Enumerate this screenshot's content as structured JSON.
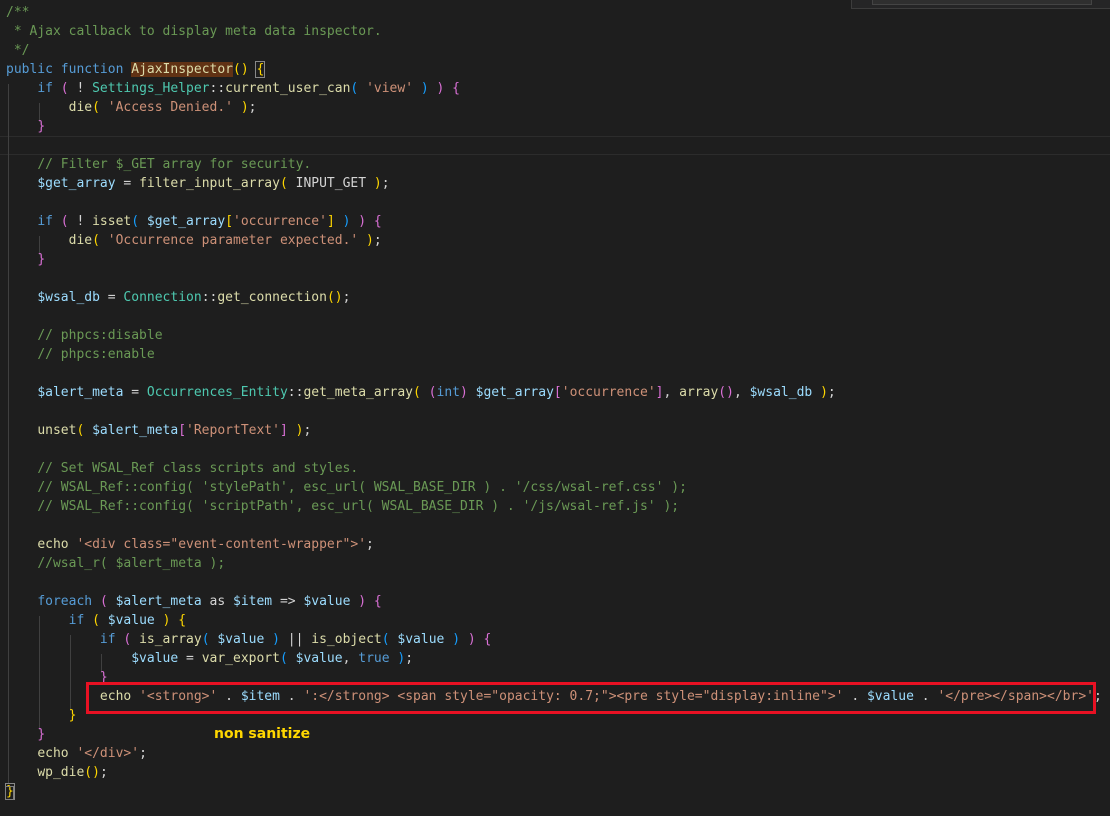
{
  "colors": {
    "background": "#1e1e1e",
    "highlight_box": "#e81123",
    "annotation": "#ffd700"
  },
  "annotation": {
    "label": "non sanitize"
  },
  "code_lines": [
    [
      [
        "/**",
        "cm"
      ]
    ],
    [
      [
        " * Ajax callback to display meta data inspector.",
        "cm"
      ]
    ],
    [
      [
        " */",
        "cm"
      ]
    ],
    [
      [
        "public",
        "kw"
      ],
      [
        " ",
        "tx"
      ],
      [
        "function",
        "kw"
      ],
      [
        " ",
        "tx"
      ],
      [
        "AjaxInspector",
        "fnhl"
      ],
      [
        "()",
        "p1"
      ],
      [
        " ",
        "tx"
      ],
      [
        "{",
        "brhl"
      ]
    ],
    [
      [
        "    ",
        "tx"
      ],
      [
        "if",
        "kw"
      ],
      [
        " ",
        "tx"
      ],
      [
        "(",
        "p2"
      ],
      [
        " ! ",
        "tx"
      ],
      [
        "Settings_Helper",
        "cls"
      ],
      [
        "::",
        "tx"
      ],
      [
        "current_user_can",
        "fn"
      ],
      [
        "(",
        "p3"
      ],
      [
        " ",
        "tx"
      ],
      [
        "'view'",
        "str"
      ],
      [
        " ",
        "tx"
      ],
      [
        ")",
        "p3"
      ],
      [
        " ",
        "tx"
      ],
      [
        ")",
        "p2"
      ],
      [
        " ",
        "tx"
      ],
      [
        "{",
        "p2"
      ]
    ],
    [
      [
        "        ",
        "tx"
      ],
      [
        "die",
        "fn"
      ],
      [
        "(",
        "p1"
      ],
      [
        " ",
        "tx"
      ],
      [
        "'Access Denied.'",
        "str"
      ],
      [
        " ",
        "tx"
      ],
      [
        ")",
        "p1"
      ],
      [
        ";",
        "tx"
      ]
    ],
    [
      [
        "    ",
        "tx"
      ],
      [
        "}",
        "p2"
      ]
    ],
    [
      [
        "",
        "tx"
      ]
    ],
    [
      [
        "    ",
        "tx"
      ],
      [
        "// Filter $_GET array for security.",
        "cm"
      ]
    ],
    [
      [
        "    ",
        "tx"
      ],
      [
        "$get_array",
        "var"
      ],
      [
        " = ",
        "tx"
      ],
      [
        "filter_input_array",
        "fn"
      ],
      [
        "(",
        "p1"
      ],
      [
        " INPUT_GET ",
        "tx"
      ],
      [
        ")",
        "p1"
      ],
      [
        ";",
        "tx"
      ]
    ],
    [
      [
        "",
        "tx"
      ]
    ],
    [
      [
        "    ",
        "tx"
      ],
      [
        "if",
        "kw"
      ],
      [
        " ",
        "tx"
      ],
      [
        "(",
        "p2"
      ],
      [
        " ! ",
        "tx"
      ],
      [
        "isset",
        "fn"
      ],
      [
        "(",
        "p3"
      ],
      [
        " ",
        "tx"
      ],
      [
        "$get_array",
        "var"
      ],
      [
        "[",
        "p1"
      ],
      [
        "'occurrence'",
        "str"
      ],
      [
        "]",
        "p1"
      ],
      [
        " ",
        "tx"
      ],
      [
        ")",
        "p3"
      ],
      [
        " ",
        "tx"
      ],
      [
        ")",
        "p2"
      ],
      [
        " ",
        "tx"
      ],
      [
        "{",
        "p2"
      ]
    ],
    [
      [
        "        ",
        "tx"
      ],
      [
        "die",
        "fn"
      ],
      [
        "(",
        "p1"
      ],
      [
        " ",
        "tx"
      ],
      [
        "'Occurrence parameter expected.'",
        "str"
      ],
      [
        " ",
        "tx"
      ],
      [
        ")",
        "p1"
      ],
      [
        ";",
        "tx"
      ]
    ],
    [
      [
        "    ",
        "tx"
      ],
      [
        "}",
        "p2"
      ]
    ],
    [
      [
        "",
        "tx"
      ]
    ],
    [
      [
        "    ",
        "tx"
      ],
      [
        "$wsal_db",
        "var"
      ],
      [
        " = ",
        "tx"
      ],
      [
        "Connection",
        "cls"
      ],
      [
        "::",
        "tx"
      ],
      [
        "get_connection",
        "fn"
      ],
      [
        "()",
        "p1"
      ],
      [
        ";",
        "tx"
      ]
    ],
    [
      [
        "",
        "tx"
      ]
    ],
    [
      [
        "    ",
        "tx"
      ],
      [
        "// phpcs:disable",
        "cm"
      ]
    ],
    [
      [
        "    ",
        "tx"
      ],
      [
        "// phpcs:enable",
        "cm"
      ]
    ],
    [
      [
        "",
        "tx"
      ]
    ],
    [
      [
        "    ",
        "tx"
      ],
      [
        "$alert_meta",
        "var"
      ],
      [
        " = ",
        "tx"
      ],
      [
        "Occurrences_Entity",
        "cls"
      ],
      [
        "::",
        "tx"
      ],
      [
        "get_meta_array",
        "fn"
      ],
      [
        "(",
        "p1"
      ],
      [
        " ",
        "tx"
      ],
      [
        "(",
        "p2"
      ],
      [
        "int",
        "kw"
      ],
      [
        ")",
        "p2"
      ],
      [
        " ",
        "tx"
      ],
      [
        "$get_array",
        "var"
      ],
      [
        "[",
        "p2"
      ],
      [
        "'occurrence'",
        "str"
      ],
      [
        "]",
        "p2"
      ],
      [
        ", ",
        "tx"
      ],
      [
        "array",
        "fn"
      ],
      [
        "()",
        "p2"
      ],
      [
        ", ",
        "tx"
      ],
      [
        "$wsal_db",
        "var"
      ],
      [
        " ",
        "tx"
      ],
      [
        ")",
        "p1"
      ],
      [
        ";",
        "tx"
      ]
    ],
    [
      [
        "",
        "tx"
      ]
    ],
    [
      [
        "    ",
        "tx"
      ],
      [
        "unset",
        "fn"
      ],
      [
        "(",
        "p1"
      ],
      [
        " ",
        "tx"
      ],
      [
        "$alert_meta",
        "var"
      ],
      [
        "[",
        "p2"
      ],
      [
        "'ReportText'",
        "str"
      ],
      [
        "]",
        "p2"
      ],
      [
        " ",
        "tx"
      ],
      [
        ")",
        "p1"
      ],
      [
        ";",
        "tx"
      ]
    ],
    [
      [
        "",
        "tx"
      ]
    ],
    [
      [
        "    ",
        "tx"
      ],
      [
        "// Set WSAL_Ref class scripts and styles.",
        "cm"
      ]
    ],
    [
      [
        "    ",
        "tx"
      ],
      [
        "// WSAL_Ref::config( 'stylePath', esc_url( WSAL_BASE_DIR ) . '/css/wsal-ref.css' );",
        "cm"
      ]
    ],
    [
      [
        "    ",
        "tx"
      ],
      [
        "// WSAL_Ref::config( 'scriptPath', esc_url( WSAL_BASE_DIR ) . '/js/wsal-ref.js' );",
        "cm"
      ]
    ],
    [
      [
        "",
        "tx"
      ]
    ],
    [
      [
        "    ",
        "tx"
      ],
      [
        "echo",
        "fn"
      ],
      [
        " ",
        "tx"
      ],
      [
        "'<div class=\"event-content-wrapper\">'",
        "str"
      ],
      [
        ";",
        "tx"
      ]
    ],
    [
      [
        "    ",
        "tx"
      ],
      [
        "//wsal_r( $alert_meta );",
        "cm"
      ]
    ],
    [
      [
        "",
        "tx"
      ]
    ],
    [
      [
        "    ",
        "tx"
      ],
      [
        "foreach",
        "kw"
      ],
      [
        " ",
        "tx"
      ],
      [
        "(",
        "p2"
      ],
      [
        " ",
        "tx"
      ],
      [
        "$alert_meta",
        "var"
      ],
      [
        " as ",
        "tx"
      ],
      [
        "$item",
        "var"
      ],
      [
        " => ",
        "tx"
      ],
      [
        "$value",
        "var"
      ],
      [
        " ",
        "tx"
      ],
      [
        ")",
        "p2"
      ],
      [
        " ",
        "tx"
      ],
      [
        "{",
        "p2"
      ]
    ],
    [
      [
        "        ",
        "tx"
      ],
      [
        "if",
        "kw"
      ],
      [
        " ",
        "tx"
      ],
      [
        "(",
        "p1"
      ],
      [
        " ",
        "tx"
      ],
      [
        "$value",
        "var"
      ],
      [
        " ",
        "tx"
      ],
      [
        ")",
        "p1"
      ],
      [
        " ",
        "tx"
      ],
      [
        "{",
        "p1"
      ]
    ],
    [
      [
        "            ",
        "tx"
      ],
      [
        "if",
        "kw"
      ],
      [
        " ",
        "tx"
      ],
      [
        "(",
        "p2"
      ],
      [
        " ",
        "tx"
      ],
      [
        "is_array",
        "fn"
      ],
      [
        "(",
        "p3"
      ],
      [
        " ",
        "tx"
      ],
      [
        "$value",
        "var"
      ],
      [
        " ",
        "tx"
      ],
      [
        ")",
        "p3"
      ],
      [
        " || ",
        "tx"
      ],
      [
        "is_object",
        "fn"
      ],
      [
        "(",
        "p3"
      ],
      [
        " ",
        "tx"
      ],
      [
        "$value",
        "var"
      ],
      [
        " ",
        "tx"
      ],
      [
        ")",
        "p3"
      ],
      [
        " ",
        "tx"
      ],
      [
        ")",
        "p2"
      ],
      [
        " ",
        "tx"
      ],
      [
        "{",
        "p2"
      ]
    ],
    [
      [
        "                ",
        "tx"
      ],
      [
        "$value",
        "var"
      ],
      [
        " = ",
        "tx"
      ],
      [
        "var_export",
        "fn"
      ],
      [
        "(",
        "p3"
      ],
      [
        " ",
        "tx"
      ],
      [
        "$value",
        "var"
      ],
      [
        ", ",
        "tx"
      ],
      [
        "true",
        "kw"
      ],
      [
        " ",
        "tx"
      ],
      [
        ")",
        "p3"
      ],
      [
        ";",
        "tx"
      ]
    ],
    [
      [
        "            ",
        "tx"
      ],
      [
        "}",
        "p2"
      ]
    ],
    [
      [
        "            ",
        "tx"
      ],
      [
        "echo",
        "fn"
      ],
      [
        " ",
        "tx"
      ],
      [
        "'<strong>'",
        "str"
      ],
      [
        " . ",
        "tx"
      ],
      [
        "$item",
        "var"
      ],
      [
        " . ",
        "tx"
      ],
      [
        "':</strong> <span style=\"opacity: 0.7;\"><pre style=\"display:inline\">'",
        "str"
      ],
      [
        " . ",
        "tx"
      ],
      [
        "$value",
        "var"
      ],
      [
        " . ",
        "tx"
      ],
      [
        "'</pre></span></br>'",
        "str"
      ],
      [
        ";",
        "tx"
      ]
    ],
    [
      [
        "        ",
        "tx"
      ],
      [
        "}",
        "p1"
      ]
    ],
    [
      [
        "    ",
        "tx"
      ],
      [
        "}",
        "p2"
      ]
    ],
    [
      [
        "    ",
        "tx"
      ],
      [
        "echo",
        "fn"
      ],
      [
        " ",
        "tx"
      ],
      [
        "'</div>'",
        "str"
      ],
      [
        ";",
        "tx"
      ]
    ],
    [
      [
        "    ",
        "tx"
      ],
      [
        "wp_die",
        "fn"
      ],
      [
        "()",
        "p1"
      ],
      [
        ";",
        "tx"
      ]
    ],
    [
      [
        "}",
        "brhl"
      ]
    ]
  ]
}
